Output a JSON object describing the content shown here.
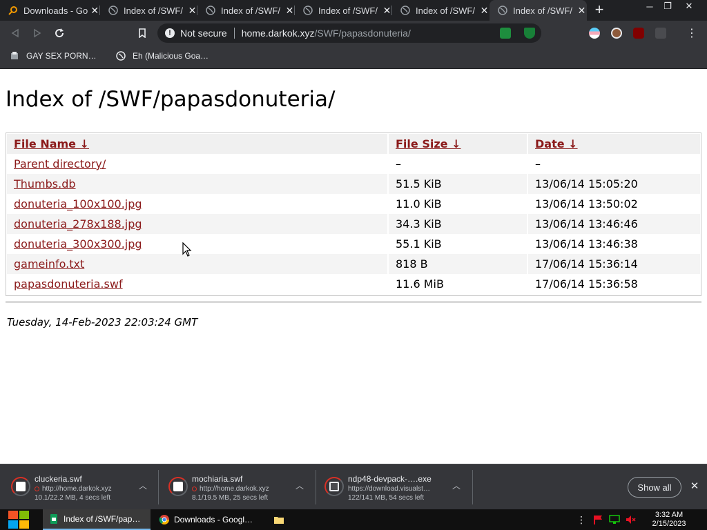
{
  "tabs": [
    {
      "label": "Downloads - Goo",
      "icon": "search-icon",
      "active": false
    },
    {
      "label": "Index of /SWF/",
      "icon": "globe-icon",
      "active": false
    },
    {
      "label": "Index of /SWF/",
      "icon": "globe-icon",
      "active": false
    },
    {
      "label": "Index of /SWF/",
      "icon": "globe-icon",
      "active": false
    },
    {
      "label": "Index of /SWF/",
      "icon": "globe-icon",
      "active": false
    },
    {
      "label": "Index of /SWF/",
      "icon": "globe-icon",
      "active": true
    }
  ],
  "toolbar": {
    "security_label": "Not secure",
    "url_host": "home.darkok.xyz",
    "url_path": "/SWF/papasdonuteria/"
  },
  "bookmarks": [
    {
      "label": "GAY SEX PORN…",
      "icon": "bookmark-app-icon"
    },
    {
      "label": "Eh (Malicious Goa…",
      "icon": "globe-icon"
    }
  ],
  "page": {
    "title": "Index of /SWF/papasdonuteria/",
    "columns": {
      "name": "File Name  ↓",
      "size": "File Size  ↓",
      "date": "Date  ↓"
    },
    "rows": [
      {
        "name": "Parent directory/",
        "size": "–",
        "date": "–"
      },
      {
        "name": "Thumbs.db",
        "size": "51.5 KiB",
        "date": "13/06/14 15:05:20"
      },
      {
        "name": "donuteria_100x100.jpg",
        "size": "11.0 KiB",
        "date": "13/06/14 13:50:02"
      },
      {
        "name": "donuteria_278x188.jpg",
        "size": "34.3 KiB",
        "date": "13/06/14 13:46:46"
      },
      {
        "name": "donuteria_300x300.jpg",
        "size": "55.1 KiB",
        "date": "13/06/14 13:46:38"
      },
      {
        "name": "gameinfo.txt",
        "size": "818 B",
        "date": "17/06/14 15:36:14"
      },
      {
        "name": "papasdonuteria.swf",
        "size": "11.6 MiB",
        "date": "17/06/14 15:36:58"
      }
    ],
    "footer": "Tuesday, 14-Feb-2023 22:03:24 GMT"
  },
  "downloads": [
    {
      "name": "cluckeria.swf",
      "url": "http://home.darkok.xyz",
      "progress": "10.1/22.2 MB, 4 secs left"
    },
    {
      "name": "mochiaria.swf",
      "url": "http://home.darkok.xyz",
      "progress": "8.1/19.5 MB, 25 secs left"
    },
    {
      "name": "ndp48-devpack-….exe",
      "url": "https://download.visualst…",
      "progress": "122/141 MB, 54 secs left"
    }
  ],
  "download_shelf": {
    "show_all": "Show all"
  },
  "taskbar": {
    "tasks": [
      {
        "label": "Index of /SWF/pap…",
        "icon": "sheets-icon",
        "active": true
      },
      {
        "label": "Downloads - Googl…",
        "icon": "chrome-icon",
        "active": false
      }
    ],
    "time": "3:32 AM",
    "date": "2/15/2023"
  },
  "colors": {
    "link": "#8b1a1a",
    "chrome_dark": "#202124",
    "chrome_toolbar": "#35363a"
  }
}
